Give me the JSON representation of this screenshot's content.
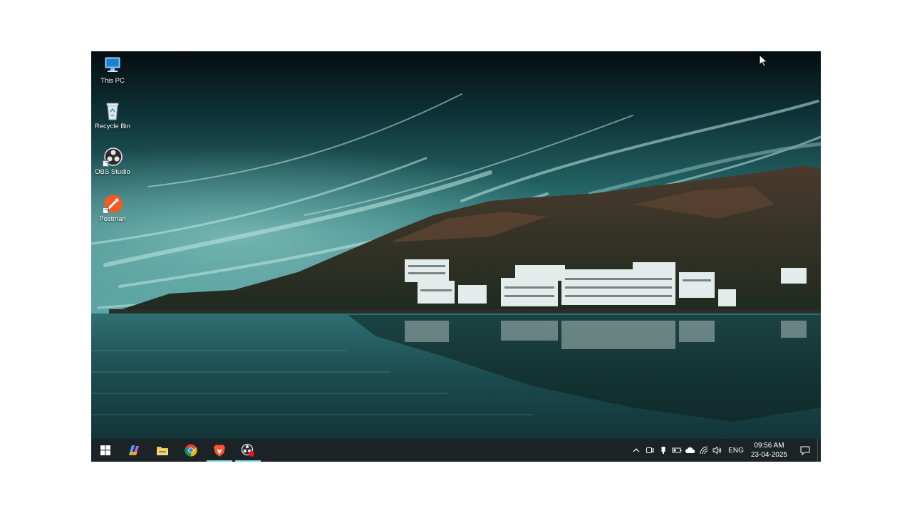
{
  "desktop": {
    "icons": [
      {
        "label": "This PC",
        "icon": "this-pc-icon"
      },
      {
        "label": "Recycle Bin",
        "icon": "recycle-bin-icon"
      },
      {
        "label": "OBS Studio",
        "icon": "obs-studio-icon"
      },
      {
        "label": "Postman",
        "icon": "postman-icon"
      }
    ]
  },
  "taskbar": {
    "pinned": [
      {
        "name": "Start",
        "icon": "windows-start-icon",
        "active": false
      },
      {
        "name": "Copilot",
        "icon": "copilot-icon",
        "active": false
      },
      {
        "name": "File Explorer",
        "icon": "file-explorer-icon",
        "active": false
      },
      {
        "name": "Google Chrome",
        "icon": "chrome-icon",
        "active": false
      },
      {
        "name": "Brave",
        "icon": "brave-icon",
        "active": true
      },
      {
        "name": "OBS Studio",
        "icon": "obs-recording-icon",
        "active": true
      }
    ],
    "tray": {
      "language": "ENG",
      "time": "09:56 AM",
      "date": "23-04-2025"
    }
  },
  "colors": {
    "taskbar_bg": "#1b2326",
    "active_indicator": "#7fd3e6",
    "sky_teal": "#2e7d80"
  }
}
